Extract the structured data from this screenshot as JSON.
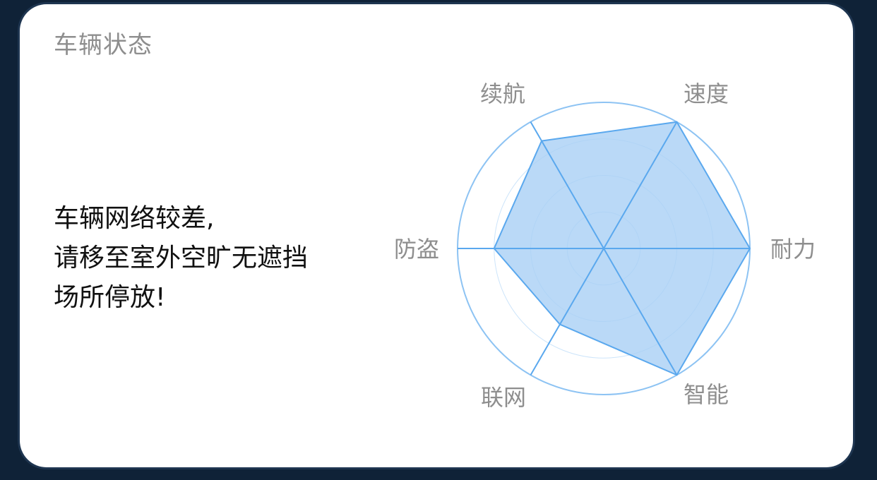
{
  "card": {
    "title": "车辆状态",
    "message_lines": [
      "车辆网络较差,",
      "请移至室外空旷无遮挡",
      "场所停放!"
    ]
  },
  "chart_data": {
    "type": "radar",
    "axes": [
      "续航",
      "速度",
      "耐力",
      "智能",
      "联网",
      "防盗"
    ],
    "values": [
      0.85,
      1.0,
      1.0,
      1.0,
      0.6,
      0.75
    ],
    "range": [
      0,
      1
    ],
    "rings": 4,
    "grid": true,
    "colors": {
      "fill": "#a9d0f5",
      "stroke": "#5aa8ee",
      "grid": "#8dc3f3"
    }
  }
}
